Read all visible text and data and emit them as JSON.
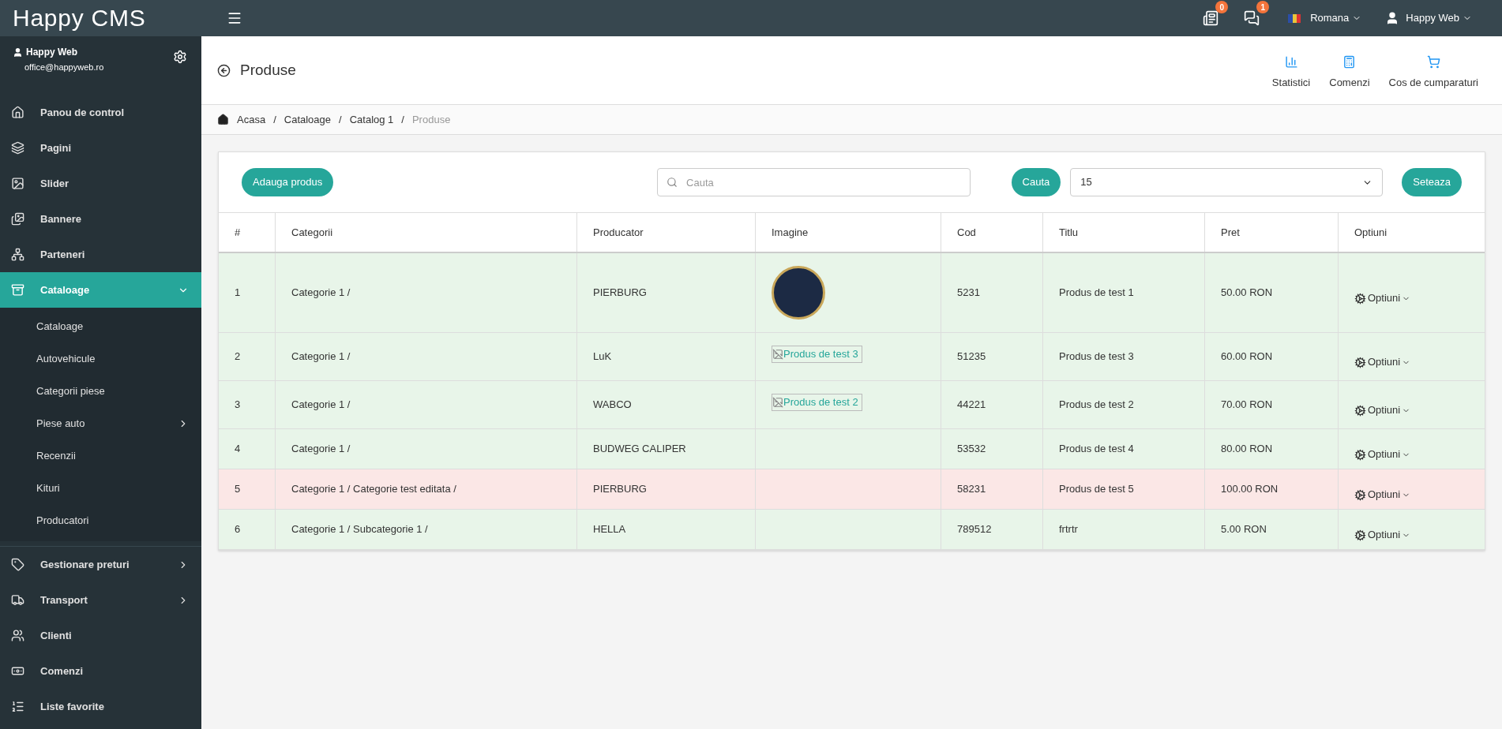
{
  "topbar": {
    "logo": "Happy CMS",
    "notifications": [
      {
        "kind": "news",
        "count": "0"
      },
      {
        "kind": "chat",
        "count": "1"
      }
    ],
    "language": "Romana",
    "user": "Happy Web"
  },
  "sidebar": {
    "user": {
      "name": "Happy Web",
      "email": "office@happyweb.ro"
    },
    "items": [
      {
        "kind": "home",
        "label": "Panou de control",
        "selected": false,
        "expandable": false
      },
      {
        "kind": "layers",
        "label": "Pagini",
        "selected": false,
        "expandable": false
      },
      {
        "kind": "image",
        "label": "Slider",
        "selected": false,
        "expandable": false
      },
      {
        "kind": "images",
        "label": "Bannere",
        "selected": false,
        "expandable": false
      },
      {
        "kind": "network",
        "label": "Parteneri",
        "selected": false,
        "expandable": false
      },
      {
        "kind": "box",
        "label": "Cataloage",
        "selected": true,
        "expandable": true,
        "expanded": true,
        "children": [
          {
            "label": "Cataloage",
            "expandable": false
          },
          {
            "label": "Autovehicule",
            "expandable": false
          },
          {
            "label": "Categorii piese",
            "expandable": false
          },
          {
            "label": "Piese auto",
            "expandable": true
          },
          {
            "label": "Recenzii",
            "expandable": false
          },
          {
            "label": "Kituri",
            "expandable": false
          },
          {
            "label": "Producatori",
            "expandable": false
          }
        ]
      },
      {
        "kind": "tag",
        "label": "Gestionare preturi",
        "selected": false,
        "expandable": true
      },
      {
        "kind": "truck",
        "label": "Transport",
        "selected": false,
        "expandable": true
      },
      {
        "kind": "users",
        "label": "Clienti",
        "selected": false,
        "expandable": false
      },
      {
        "kind": "money",
        "label": "Comenzi",
        "selected": false,
        "expandable": false
      },
      {
        "kind": "list",
        "label": "Liste favorite",
        "selected": false,
        "expandable": false
      }
    ]
  },
  "page": {
    "title": "Produse",
    "actions": [
      {
        "kind": "chart",
        "label": "Statistici"
      },
      {
        "kind": "calculator",
        "label": "Comenzi"
      },
      {
        "kind": "cart",
        "label": "Cos de cumparaturi"
      }
    ],
    "breadcrumb": [
      {
        "kind": "link",
        "label": "Acasa",
        "current": false
      },
      {
        "kind": "separator",
        "label": "/"
      },
      {
        "kind": "link",
        "label": "Cataloage",
        "current": false
      },
      {
        "kind": "separator",
        "label": "/"
      },
      {
        "kind": "link",
        "label": "Catalog 1",
        "current": false
      },
      {
        "kind": "separator",
        "label": "/"
      },
      {
        "kind": "link",
        "label": "Produse",
        "current": true
      }
    ]
  },
  "toolbar": {
    "add_button": "Adauga produs",
    "search": {
      "placeholder": "Cauta"
    },
    "search_button": "Cauta",
    "page_size": "15",
    "set_button": "Seteaza"
  },
  "table": {
    "columns": [
      "#",
      "Categorii",
      "Producator",
      "Imagine",
      "Cod",
      "Titlu",
      "Pret",
      "Optiuni"
    ],
    "rows": [
      {
        "num": "1",
        "category": "Categorie 1 /",
        "producer": "PIERBURG",
        "image": {
          "kind": "logo"
        },
        "code": "5231",
        "title": "Produs de test 1",
        "price": "50.00 RON",
        "options": "Optiuni",
        "color": "#e8f5e9"
      },
      {
        "num": "2",
        "category": "Categorie 1 /",
        "producer": "LuK",
        "image": {
          "kind": "broken",
          "alt": "Produs de test 3"
        },
        "code": "51235",
        "title": "Produs de test 3",
        "price": "60.00 RON",
        "options": "Optiuni",
        "color": "#e8f5e9"
      },
      {
        "num": "3",
        "category": "Categorie 1 /",
        "producer": "WABCO",
        "image": {
          "kind": "broken",
          "alt": "Produs de test 2"
        },
        "code": "44221",
        "title": "Produs de test 2",
        "price": "70.00 RON",
        "options": "Optiuni",
        "color": "#e8f5e9"
      },
      {
        "num": "4",
        "category": "Categorie 1 /",
        "producer": "BUDWEG CALIPER",
        "image": {
          "kind": "none"
        },
        "code": "53532",
        "title": "Produs de test 4",
        "price": "80.00 RON",
        "options": "Optiuni",
        "color": "#e8f5e9"
      },
      {
        "num": "5",
        "category": "Categorie 1 / Categorie test editata /",
        "producer": "PIERBURG",
        "image": {
          "kind": "none"
        },
        "code": "58231",
        "title": "Produs de test 5",
        "price": "100.00 RON",
        "options": "Optiuni",
        "color": "#fbe7e6"
      },
      {
        "num": "6",
        "category": "Categorie 1 / Subcategorie 1 /",
        "producer": "HELLA",
        "image": {
          "kind": "none"
        },
        "code": "789512",
        "title": "frtrtr",
        "price": "5.00 RON",
        "options": "Optiuni",
        "color": "#e8f5e9"
      }
    ]
  }
}
